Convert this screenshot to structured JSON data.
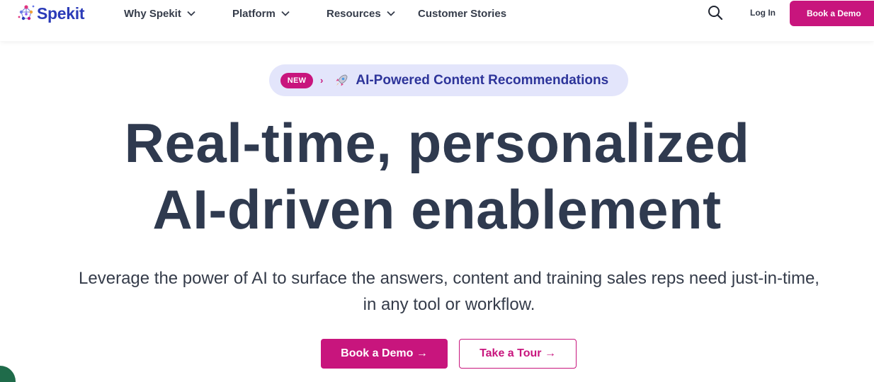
{
  "nav": {
    "logo_text": "Spekit",
    "items": [
      {
        "label": "Why Spekit",
        "has_dropdown": true
      },
      {
        "label": "Platform",
        "has_dropdown": true
      },
      {
        "label": "Resources",
        "has_dropdown": true
      },
      {
        "label": "Customer Stories",
        "has_dropdown": false
      }
    ],
    "search_icon": "search-icon",
    "login_label": "Log In",
    "book_demo_label": "Book a Demo"
  },
  "badge": {
    "new_label": "NEW",
    "arrow": "›",
    "icon": "rocket-icon",
    "text": "AI-Powered Content Recommendations"
  },
  "hero": {
    "headline_line1": "Real-time, personalized",
    "headline_line2": "AI-driven enablement",
    "subheadline": "Leverage the power of AI to surface the answers, content and training sales reps need just-in-time, in any tool or workflow.",
    "primary_cta": "Book a Demo →",
    "secondary_cta": "Take a Tour →"
  },
  "colors": {
    "brand_magenta": "#c8157d",
    "brand_blue": "#2b3bb8",
    "badge_bg": "#e3e5fb",
    "heading": "#2f3a4f",
    "chat_green": "#1f6b4a"
  }
}
